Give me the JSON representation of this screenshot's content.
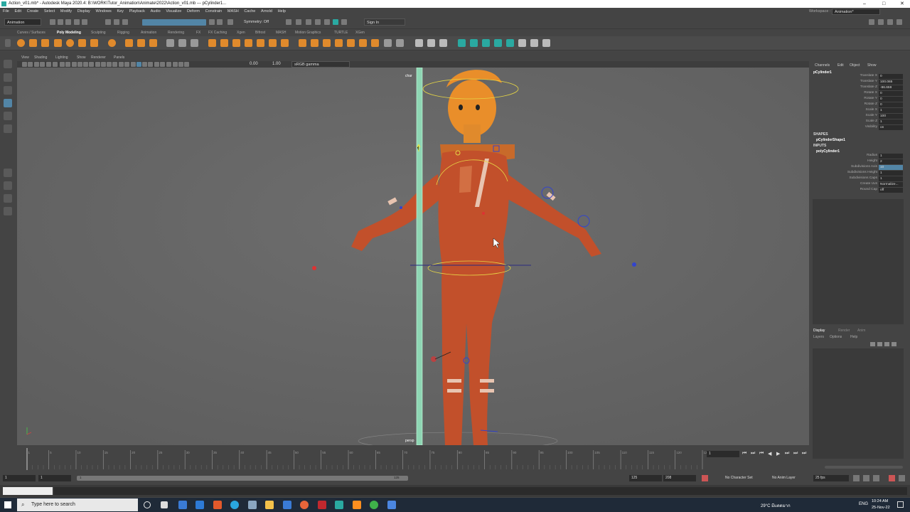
{
  "title": "Action_v01.mb* - Autodesk Maya 2020.4: B:\\WORK\\Tutor_Animation\\Animate\\2022\\Action_v01.mb  ---  pCylinder1...",
  "window_controls": [
    "–",
    "□",
    "✕"
  ],
  "menu": [
    "File",
    "Edit",
    "Create",
    "Select",
    "Modify",
    "Display",
    "Windows",
    "Key",
    "Playback",
    "Audio",
    "Visualize",
    "Deform",
    "Constrain",
    "MASH",
    "Cache",
    "Arnold",
    "Help"
  ],
  "workspace_label": "Workspace :",
  "workspace_value": "Animation*",
  "menuset": "Animation",
  "symmetry": "Symmetry: Off",
  "sign_in": "Sign In",
  "shelf_tabs": [
    "Curves / Surfaces",
    "Poly Modeling",
    "Sculpting",
    "Rigging",
    "Animation",
    "Rendering",
    "FX",
    "FX Caching",
    "Xgen",
    "Bifrost",
    "MASH",
    "Motion Graphics",
    "TURTLE",
    "XGen"
  ],
  "shelf_active": "Poly Modeling",
  "panel_menu": [
    "View",
    "Shading",
    "Lighting",
    "Show",
    "Renderer",
    "Panels"
  ],
  "panel_values": {
    "exposure": "0.00",
    "gamma": "1.00",
    "color_space": "sRGB gamma"
  },
  "viewport_labels": {
    "camera_top": "char",
    "camera_bottom": "persp"
  },
  "channel_menu": [
    "Channels",
    "Edit",
    "Object",
    "Show"
  ],
  "object_name": "pCylinder1",
  "channels": [
    {
      "name": "Translate X",
      "value": "0"
    },
    {
      "name": "Translate Y",
      "value": "100.065"
    },
    {
      "name": "Translate Z",
      "value": "-86.659"
    },
    {
      "name": "Rotate X",
      "value": "0"
    },
    {
      "name": "Rotate Y",
      "value": "0"
    },
    {
      "name": "Rotate Z",
      "value": "0"
    },
    {
      "name": "Scale X",
      "value": "1"
    },
    {
      "name": "Scale Y",
      "value": "100"
    },
    {
      "name": "Scale Z",
      "value": "1"
    },
    {
      "name": "Visibility",
      "value": "on"
    }
  ],
  "shapes_header": "SHAPES",
  "shape_name": "pCylinderShape1",
  "inputs_header": "INPUTS",
  "input_name": "polyCylinder1",
  "inputs": [
    {
      "name": "Radius",
      "value": "1"
    },
    {
      "name": "Height",
      "value": "2"
    },
    {
      "name": "Subdivisions Axis",
      "value": "10"
    },
    {
      "name": "Subdivisions Height",
      "value": "1"
    },
    {
      "name": "Subdivisions Caps",
      "value": "1"
    },
    {
      "name": "Create Uvs",
      "value": "Normalize..."
    },
    {
      "name": "Round Cap",
      "value": "off"
    }
  ],
  "layer_tabs": [
    "Display",
    "Render",
    "Anim"
  ],
  "layer_menu": [
    "Layers",
    "Options",
    "Help"
  ],
  "timeline": {
    "ticks": [
      "1",
      "5",
      "10",
      "15",
      "20",
      "25",
      "30",
      "35",
      "40",
      "45",
      "50",
      "55",
      "60",
      "65",
      "70",
      "75",
      "80",
      "85",
      "90",
      "95",
      "100",
      "105",
      "110",
      "115",
      "120",
      "125"
    ],
    "current_frame": "1"
  },
  "range": {
    "start": "1",
    "inner_start": "1",
    "inner_end": "125",
    "end_a": "125",
    "end_b": "208"
  },
  "character_set": "No Character Set",
  "anim_layer": "No Anim Layer",
  "fps": "25 fps",
  "taskbar": {
    "search": "Type here to search",
    "weather": "29°C  มีแดดมาก",
    "lang": "ENG",
    "time": "10:24 AM",
    "date": "25-Nov-22"
  }
}
